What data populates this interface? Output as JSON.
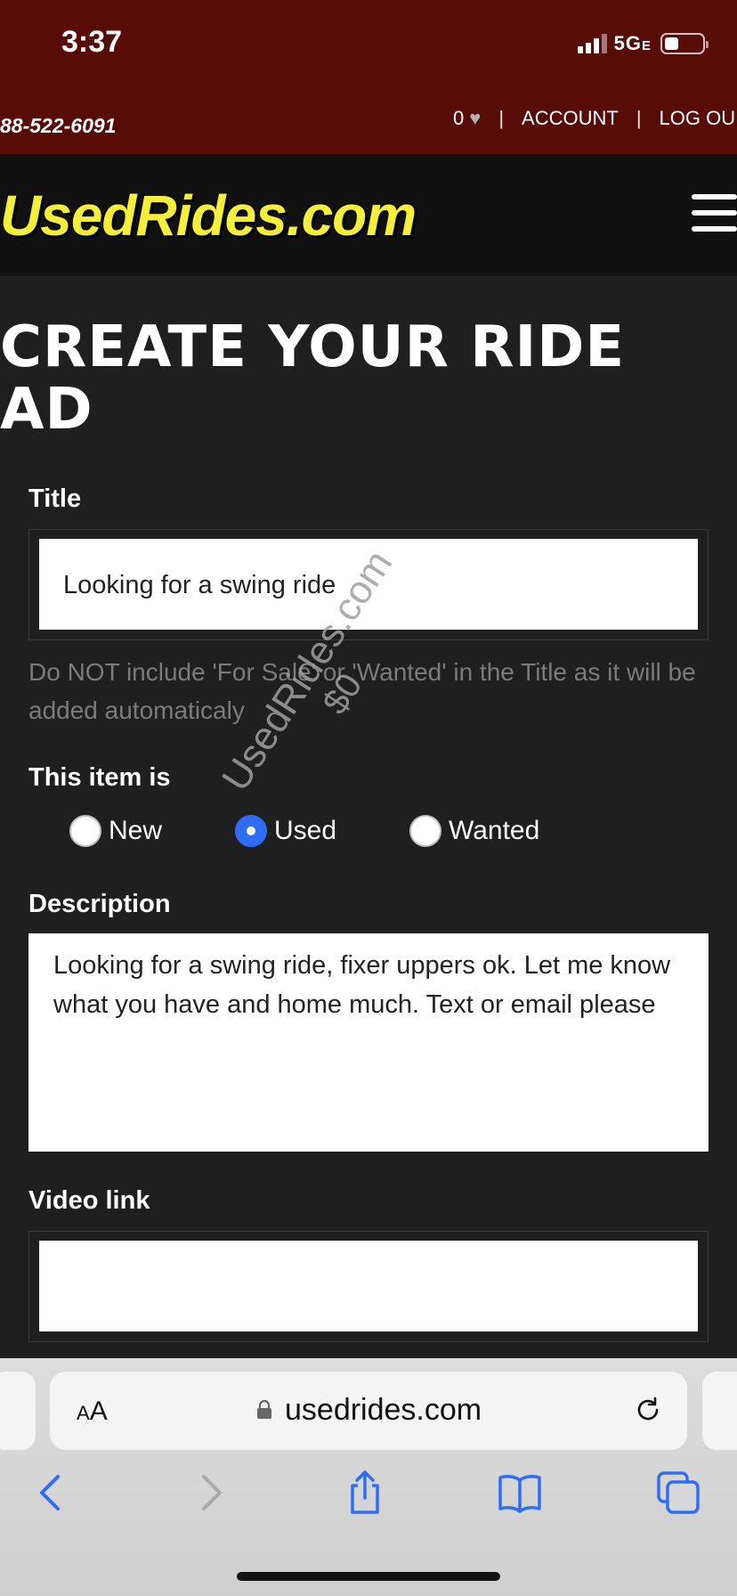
{
  "status_bar": {
    "time": "3:37",
    "network": "5G",
    "network_suffix": "E",
    "battery_level": 0.35
  },
  "top_strip": {
    "phone": "88-522-6091",
    "favorites_count": "0",
    "account": "ACCOUNT",
    "logout": "LOG OU",
    "separator": "|"
  },
  "header": {
    "logo": "UsedRides.com"
  },
  "page": {
    "title_line1": "CREATE YOUR RIDE",
    "title_line2": "AD"
  },
  "form": {
    "title_label": "Title",
    "title_value": "Looking for a swing ride",
    "title_hint": "Do NOT include 'For Sale' or 'Wanted' in the Title as it will be added automaticaly",
    "condition_label": "This item is",
    "condition_options": [
      "New",
      "Used",
      "Wanted"
    ],
    "condition_selected": "Used",
    "description_label": "Description",
    "description_value": "Looking for a swing ride, fixer uppers ok. Let me know what you have and home much. Text or email please",
    "video_label": "Video link",
    "video_value": ""
  },
  "watermark": {
    "line1": "UsedRides.com",
    "line2": "$0"
  },
  "browser": {
    "aa_big": "A",
    "aa_small": "A",
    "url": "usedrides.com"
  },
  "colors": {
    "top_strip": "#570c08",
    "brand_bar": "#111111",
    "page_bg": "#1f1f1f",
    "logo_yellow": "#f6ef3a",
    "radio_selected": "#2f6df6"
  }
}
